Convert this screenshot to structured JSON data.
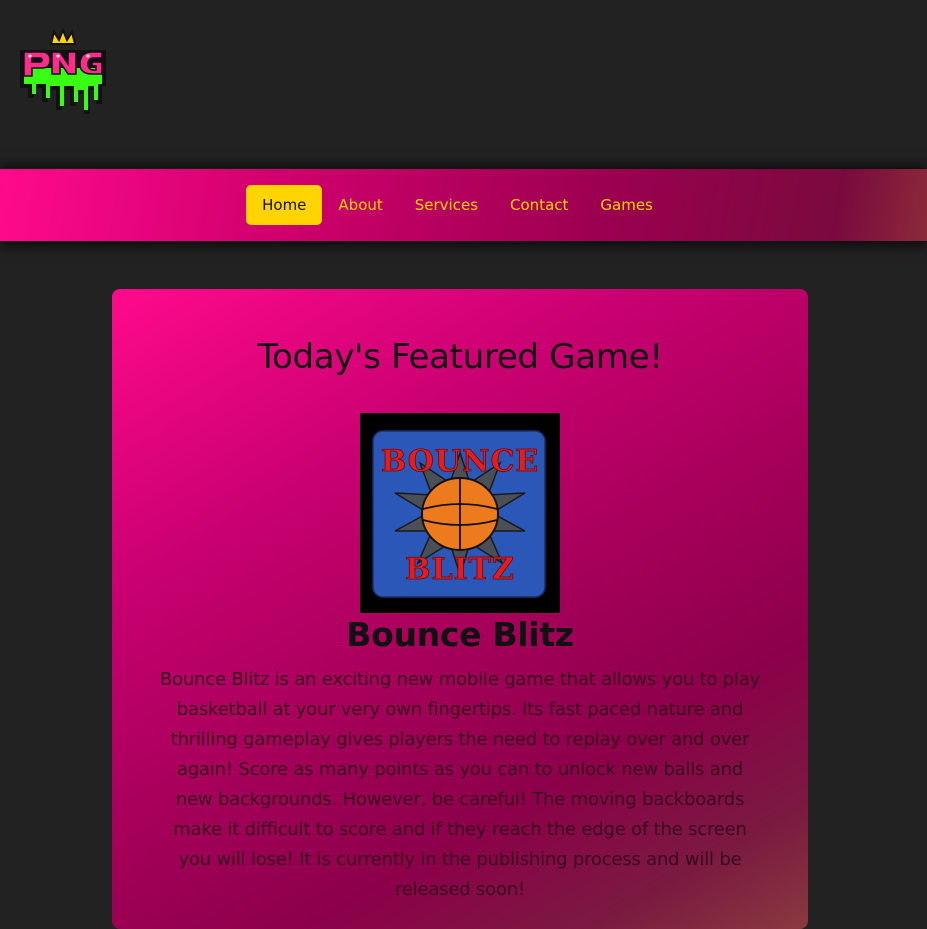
{
  "logo": {
    "text": "PNG",
    "colors": {
      "pink": "#ff2d8a",
      "green": "#39ff14",
      "crown": "#ffd400"
    }
  },
  "nav": {
    "items": [
      {
        "label": "Home",
        "active": true
      },
      {
        "label": "About",
        "active": false
      },
      {
        "label": "Services",
        "active": false
      },
      {
        "label": "Contact",
        "active": false
      },
      {
        "label": "Games",
        "active": false
      }
    ]
  },
  "featured": {
    "heading": "Today's Featured Game!",
    "game_image_text_top": "BOUNCE",
    "game_image_text_bottom": "BLITZ",
    "game_name": "Bounce Blitz",
    "description": "Bounce Blitz is an exciting new mobile game that allows you to play basketball at your very own fingertips. Its fast paced nature and thrilling gameplay gives players the need to replay over and over again! Score as many points as you can to unlock new balls and new backgrounds. However, be careful! The moving backboards make it difficult to score and if they reach the edge of the screen you will lose! It is currently in the publishing process and will be released soon!"
  },
  "colors": {
    "background": "#222222",
    "accent_pink": "#ff0a8c",
    "accent_yellow": "#ffd400",
    "game_tile_blue": "#2b57b8",
    "game_text_red": "#e02020",
    "ball_orange": "#ee7a1e"
  }
}
